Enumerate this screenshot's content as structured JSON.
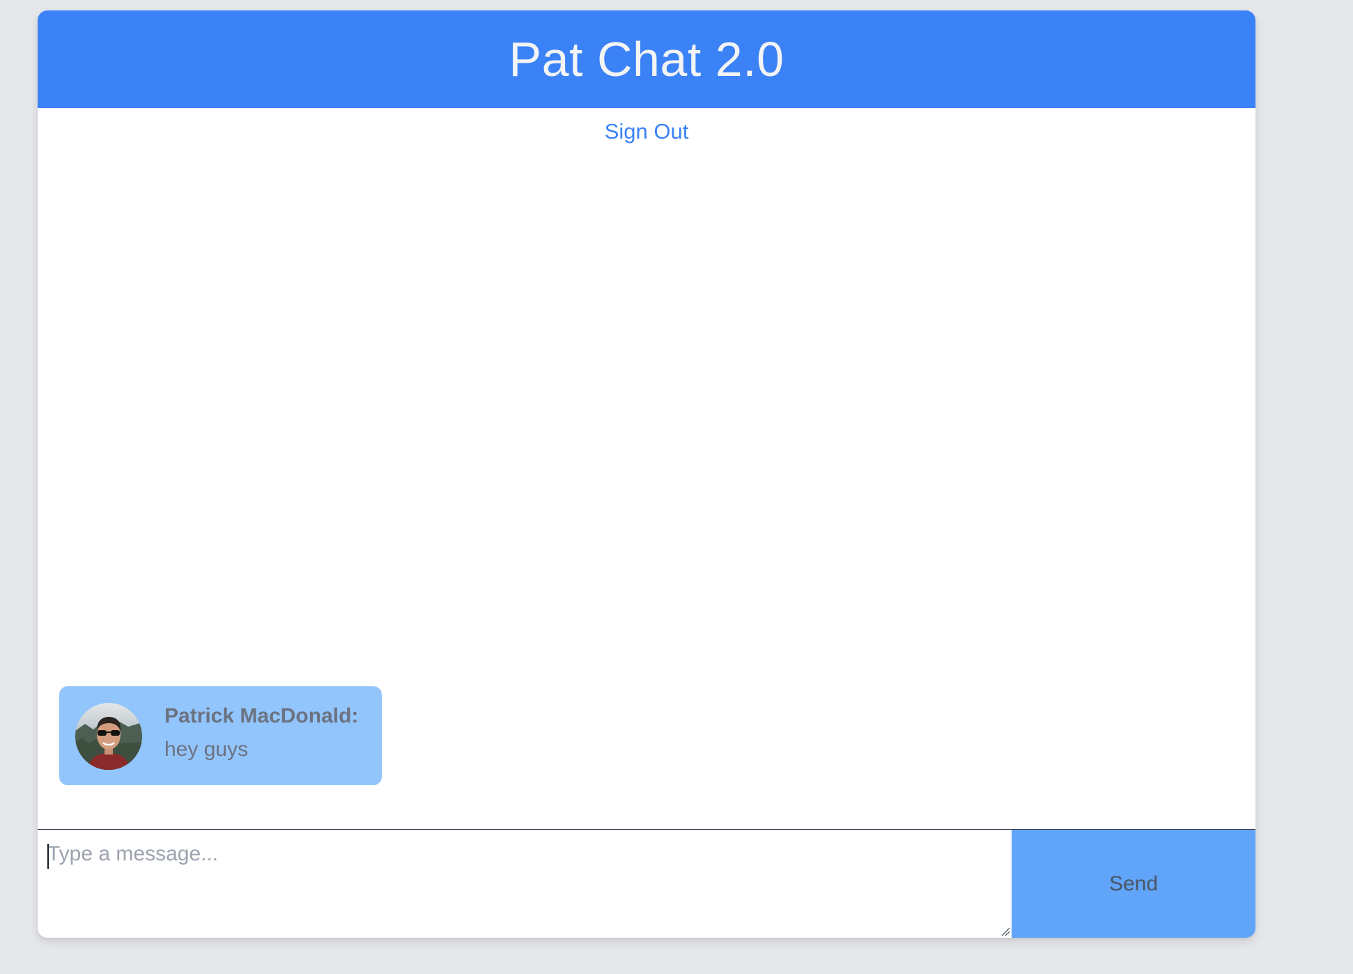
{
  "header": {
    "title": "Pat Chat 2.0"
  },
  "auth": {
    "sign_out_label": "Sign Out"
  },
  "messages": [
    {
      "author": "Patrick MacDonald:",
      "text": "hey guys",
      "avatar_icon": "user-avatar-photo"
    }
  ],
  "composer": {
    "placeholder": "Type a message...",
    "value": "",
    "send_label": "Send"
  },
  "colors": {
    "header_bg": "#3b82f6",
    "link": "#3b82f6",
    "bubble_bg": "#93c5fd",
    "send_bg": "#60a5fa",
    "page_bg": "#e5e7eb"
  }
}
